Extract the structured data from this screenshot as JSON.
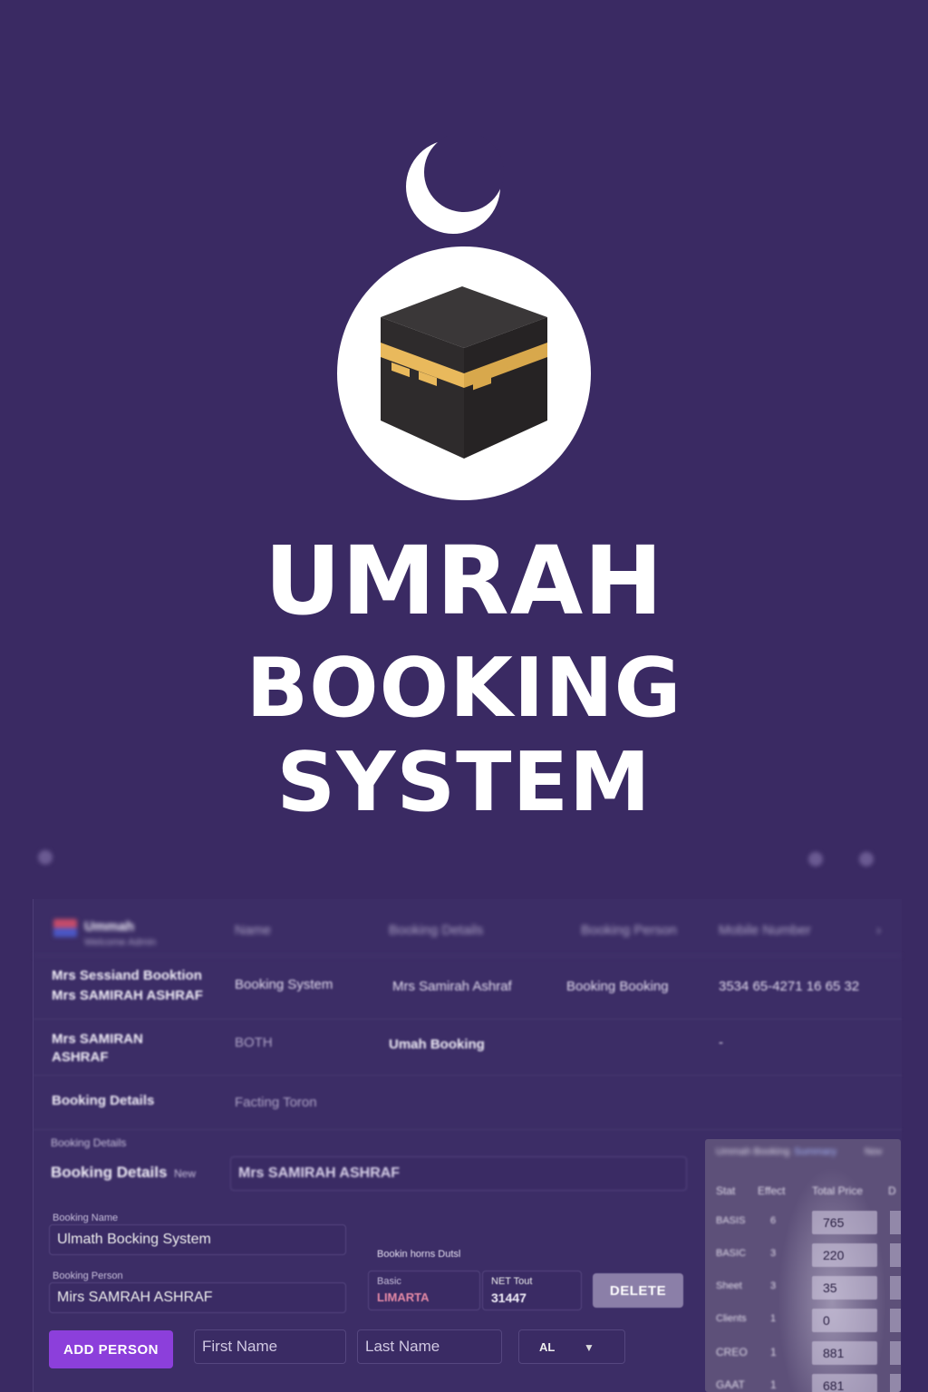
{
  "hero": {
    "title_line1": "UMRAH",
    "title_line2": "BOOKING",
    "title_line3": "SYSTEM",
    "logo_icon": "kaaba-crescent-icon",
    "colors": {
      "background": "#3a2a63",
      "gold": "#e9b95c",
      "kaaba": "#2e2b2c"
    }
  },
  "table": {
    "header": {
      "col1_title": "Ummah",
      "col1_sub": "Welcome Admin",
      "col2": "Name",
      "col3": "Booking Details",
      "col4": "Booking Person",
      "col5": "Mobile Number"
    },
    "rows": [
      {
        "c1_line1": "Mrs Sessiand Booktion",
        "c1_line2": "Mrs SAMIRAH ASHRAF",
        "c2": "Booking System",
        "c3": "Mrs Samirah Ashraf",
        "c4": "Booking Booking",
        "c5": "3534 65-4271 16 65 32"
      },
      {
        "c1_line1": "Mrs SAMIRAN",
        "c1_line2": "ASHRAF",
        "c2": "BOTH",
        "c3": "Umah Booking",
        "c5": "-"
      },
      {
        "c1": "Booking Details",
        "c2": "Facting Toron"
      }
    ]
  },
  "form": {
    "section_label": "Booking Details",
    "details_label": "Booking Details",
    "details_hint": "New",
    "details_value": "Mrs SAMIRAH ASHRAF",
    "system_label": "Booking Name",
    "system_value": "Ulmath Bocking System",
    "person_label": "Booking Person",
    "person_value": "Mirs SAMRAH ASHRAF",
    "items_label": "Bookin horns Dutsl",
    "basic_label": "Basic",
    "basic_value": "LIMARTA",
    "net_label": "NET Tout",
    "net_value": "31447",
    "delete_label": "DELETE",
    "add_person_label": "ADD PERSON",
    "first_name_placeholder": "First Name",
    "last_name_placeholder": "Last Name",
    "title_select_value": "AL",
    "colors": {
      "add_button": "#8c3fdb",
      "delete_button": "#8b7fa8",
      "basic_value": "#e58aa6"
    }
  },
  "sheet": {
    "header": [
      "Ummah Booking",
      "Summary",
      "Nov"
    ],
    "columns": [
      "Stat",
      "Effect",
      "Total Price",
      "D"
    ],
    "rows": [
      {
        "code": "BASIS",
        "qty": "6",
        "value": "765"
      },
      {
        "code": "BASIC",
        "qty": "3",
        "value": "220"
      },
      {
        "code": "Sheet",
        "qty": "3",
        "value": "35"
      },
      {
        "code": "Clients",
        "qty": "1",
        "value": "0"
      },
      {
        "code": "CREO",
        "qty": "1",
        "value": "881"
      },
      {
        "code": "GAAT",
        "qty": "1",
        "value": "681"
      }
    ]
  }
}
